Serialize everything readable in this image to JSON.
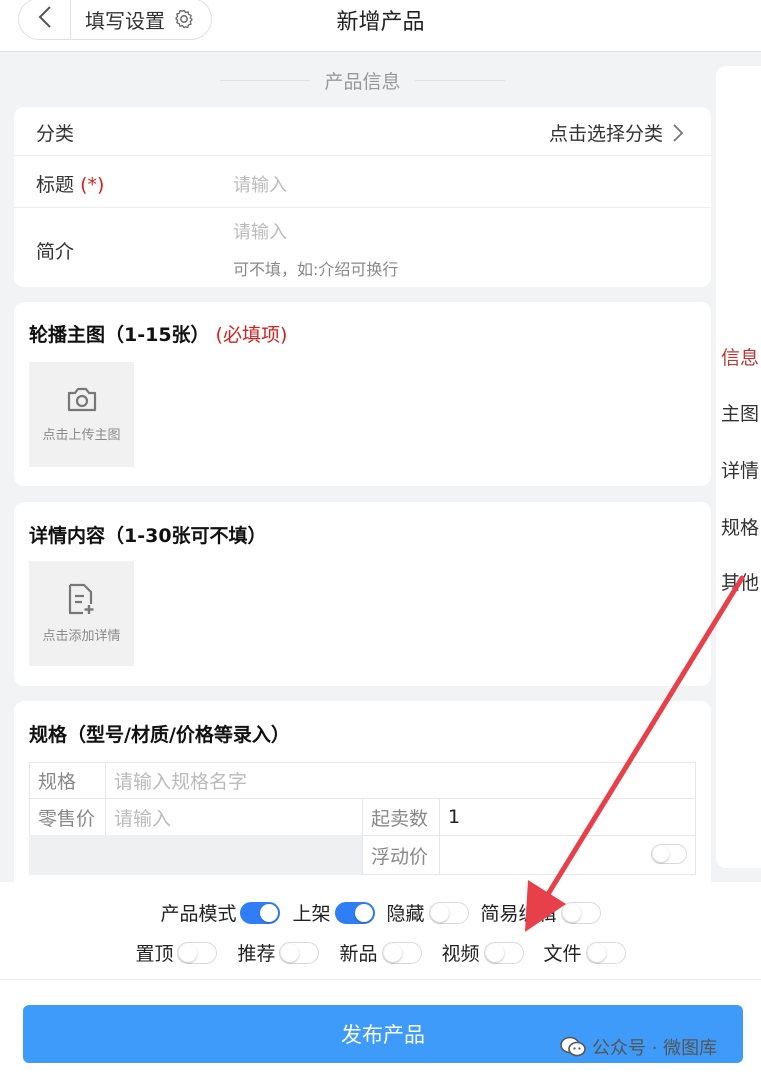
{
  "header": {
    "capsule_label": "填写设置",
    "title": "新增产品"
  },
  "section_title": "产品信息",
  "info_card": {
    "category_label": "分类",
    "category_picker": "点击选择分类",
    "title_label": "标题",
    "title_required": "(*)",
    "title_placeholder": "请输入",
    "intro_label": "简介",
    "intro_placeholder": "请输入",
    "intro_hint": "可不填，如:介绍可换行"
  },
  "carousel": {
    "heading": "轮播主图（1-15张）",
    "required": "(必填项)",
    "upload_label": "点击上传主图"
  },
  "details": {
    "heading": "详情内容（1-30张可不填）",
    "upload_label": "点击添加详情"
  },
  "spec": {
    "heading": "规格（型号/材质/价格等录入）",
    "spec_label": "规格",
    "spec_placeholder": "请输入规格名字",
    "retail_label": "零售价",
    "retail_placeholder": "请输入",
    "min_qty_label": "起卖数",
    "min_qty_value": "1",
    "float_price_label": "浮动价"
  },
  "side_nav": [
    "信息",
    "主图",
    "详情",
    "规格",
    "其他"
  ],
  "toggles_row1": [
    {
      "label": "产品模式",
      "on": true
    },
    {
      "label": "上架",
      "on": true
    },
    {
      "label": "隐藏",
      "on": false
    },
    {
      "label": "简易编辑",
      "on": false
    }
  ],
  "toggles_row2": [
    {
      "label": "置顶",
      "on": false
    },
    {
      "label": "推荐",
      "on": false
    },
    {
      "label": "新品",
      "on": false
    },
    {
      "label": "视频",
      "on": false
    },
    {
      "label": "文件",
      "on": false
    }
  ],
  "publish_button": "发布产品",
  "watermark": "公众号 · 微图库",
  "colors": {
    "accent": "#3f9bf9",
    "switch_on": "#2f7ef5",
    "required": "#d32121",
    "annotation_arrow": "#e8404a"
  }
}
